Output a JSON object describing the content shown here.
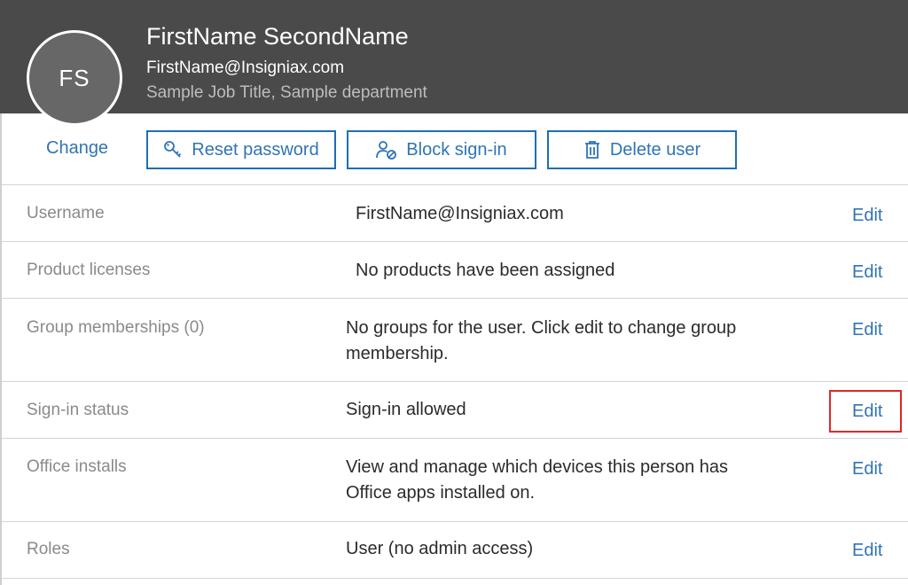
{
  "header": {
    "avatar_initials": "FS",
    "name": "FirstName SecondName",
    "email": "FirstName@Insigniax.com",
    "job_title": "Sample Job Title, Sample department",
    "background_color": "#4a4a4a"
  },
  "actions": {
    "change_label": "Change",
    "reset_password_label": "Reset password",
    "block_signin_label": "Block sign-in",
    "delete_user_label": "Delete user"
  },
  "properties": [
    {
      "label": "Username",
      "value": "FirstName@Insigniax.com",
      "edit_label": "Edit"
    },
    {
      "label": "Product licenses",
      "value": "No products have been assigned",
      "edit_label": "Edit"
    },
    {
      "label": "Group memberships (0)",
      "value": "No groups for the user. Click edit to change group membership.",
      "edit_label": "Edit"
    },
    {
      "label": "Sign-in status",
      "value": "Sign-in allowed",
      "edit_label": "Edit"
    },
    {
      "label": "Office installs",
      "value": "View and manage which devices this person has Office apps installed on.",
      "edit_label": "Edit"
    },
    {
      "label": "Roles",
      "value": "User (no admin access)",
      "edit_label": "Edit"
    }
  ],
  "colors": {
    "accent": "#2f74b5",
    "button_border": "#1f6eb3",
    "highlight": "#e02828"
  },
  "icons": {
    "reset_password": "key-icon",
    "block_signin": "user-block-icon",
    "delete_user": "trash-icon"
  }
}
